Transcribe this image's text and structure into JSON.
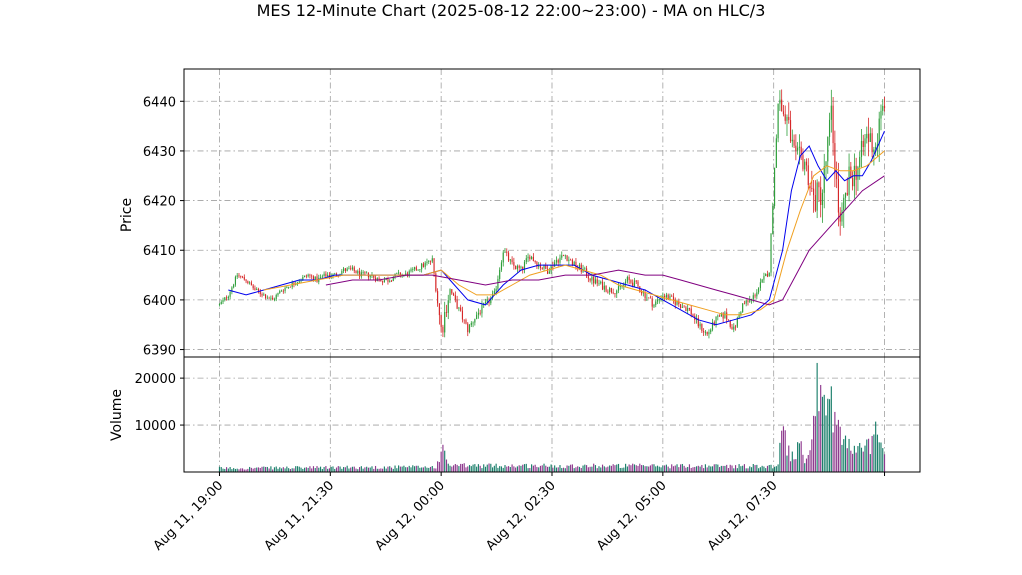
{
  "chart_data": {
    "type": "candlestick",
    "title": "MES 12-Minute Chart (2025-08-12 22:00~23:00) - MA on HLC/3",
    "price_panel": {
      "ylabel": "Price",
      "ylim": [
        6388.5,
        6446.5
      ],
      "yticks": [
        6390,
        6400,
        6410,
        6420,
        6430,
        6440
      ],
      "grid": true
    },
    "volume_panel": {
      "ylabel": "Volume",
      "ylim": [
        0,
        24500
      ],
      "yticks": [
        10000,
        20000
      ],
      "grid": true
    },
    "x_axis": {
      "tick_labels": [
        "Aug 11, 19:00",
        "Aug 11, 21:30",
        "Aug 12, 00:00",
        "Aug 12, 02:30",
        "Aug 12, 05:00",
        "Aug 12, 07:30"
      ],
      "tick_index": [
        0,
        12.5,
        25,
        37.5,
        50,
        62.5,
        75
      ],
      "range": [
        -4,
        79
      ]
    },
    "colors": {
      "up": "#2e9e3a",
      "down": "#d62728",
      "vol_up": "#1b7f6b",
      "vol_down": "#8e3a8e",
      "ma_fast": "#0000ee",
      "ma_mid": "#f0a020",
      "ma_slow": "#800080"
    },
    "close_path": [
      [
        0,
        6399
      ],
      [
        1,
        6401
      ],
      [
        2,
        6405
      ],
      [
        3,
        6404
      ],
      [
        4,
        6402
      ],
      [
        5,
        6401
      ],
      [
        6,
        6400
      ],
      [
        7,
        6402
      ],
      [
        8,
        6403
      ],
      [
        9,
        6404
      ],
      [
        10,
        6405
      ],
      [
        11,
        6404
      ],
      [
        12,
        6405
      ],
      [
        13,
        6405
      ],
      [
        14,
        6406
      ],
      [
        15,
        6406
      ],
      [
        16,
        6405
      ],
      [
        17,
        6405
      ],
      [
        18,
        6404
      ],
      [
        19,
        6404
      ],
      [
        20,
        6405
      ],
      [
        21,
        6405
      ],
      [
        22,
        6406
      ],
      [
        23,
        6407
      ],
      [
        24,
        6408
      ],
      [
        25,
        6394
      ],
      [
        26,
        6402
      ],
      [
        27,
        6398
      ],
      [
        28,
        6394
      ],
      [
        29,
        6397
      ],
      [
        30,
        6399
      ],
      [
        31,
        6401
      ],
      [
        32,
        6410
      ],
      [
        33,
        6407
      ],
      [
        34,
        6406
      ],
      [
        35,
        6409
      ],
      [
        36,
        6407
      ],
      [
        37,
        6406
      ],
      [
        38,
        6408
      ],
      [
        39,
        6409
      ],
      [
        40,
        6407
      ],
      [
        41,
        6406
      ],
      [
        42,
        6404
      ],
      [
        43,
        6403
      ],
      [
        44,
        6402
      ],
      [
        45,
        6402
      ],
      [
        46,
        6404
      ],
      [
        47,
        6403
      ],
      [
        48,
        6401
      ],
      [
        49,
        6399
      ],
      [
        50,
        6401
      ],
      [
        51,
        6400
      ],
      [
        52,
        6399
      ],
      [
        53,
        6398
      ],
      [
        54,
        6395
      ],
      [
        55,
        6393
      ],
      [
        56,
        6396
      ],
      [
        57,
        6397
      ],
      [
        58,
        6394
      ],
      [
        59,
        6399
      ],
      [
        60,
        6400
      ],
      [
        61,
        6403
      ],
      [
        62,
        6406
      ],
      [
        63,
        6440
      ],
      [
        64,
        6436
      ],
      [
        65,
        6428
      ],
      [
        66,
        6428
      ],
      [
        67,
        6420
      ],
      [
        68,
        6422
      ],
      [
        69,
        6437
      ],
      [
        70,
        6414
      ],
      [
        71,
        6424
      ],
      [
        72,
        6427
      ],
      [
        73,
        6433
      ],
      [
        74,
        6431
      ],
      [
        75,
        6440
      ]
    ],
    "moving_averages": [
      {
        "key": "fast",
        "values": [
          [
            1,
            6402
          ],
          [
            3,
            6401
          ],
          [
            5,
            6402
          ],
          [
            7,
            6403
          ],
          [
            9,
            6404
          ],
          [
            11,
            6404
          ],
          [
            13,
            6405
          ],
          [
            15,
            6405
          ],
          [
            17,
            6405
          ],
          [
            19,
            6405
          ],
          [
            21,
            6405
          ],
          [
            23,
            6405
          ],
          [
            25,
            6406
          ],
          [
            26,
            6404
          ],
          [
            28,
            6400
          ],
          [
            30,
            6399
          ],
          [
            32,
            6403
          ],
          [
            34,
            6406
          ],
          [
            36,
            6407
          ],
          [
            38,
            6407
          ],
          [
            40,
            6407
          ],
          [
            42,
            6405
          ],
          [
            44,
            6404
          ],
          [
            46,
            6403
          ],
          [
            48,
            6402
          ],
          [
            50,
            6400
          ],
          [
            52,
            6398
          ],
          [
            54,
            6396
          ],
          [
            56,
            6395
          ],
          [
            58,
            6396
          ],
          [
            60,
            6397
          ],
          [
            62,
            6400
          ],
          [
            63.5,
            6410
          ],
          [
            64.5,
            6422
          ],
          [
            65.5,
            6429
          ],
          [
            66.5,
            6431
          ],
          [
            67.5,
            6427
          ],
          [
            68.5,
            6424
          ],
          [
            69.5,
            6426
          ],
          [
            70.5,
            6424
          ],
          [
            71.5,
            6425
          ],
          [
            72.5,
            6425
          ],
          [
            73.5,
            6428
          ],
          [
            75,
            6434
          ]
        ]
      },
      {
        "key": "mid",
        "values": [
          [
            5,
            6402
          ],
          [
            8,
            6403
          ],
          [
            11,
            6404
          ],
          [
            14,
            6405
          ],
          [
            17,
            6405
          ],
          [
            20,
            6405
          ],
          [
            23,
            6405
          ],
          [
            25,
            6406
          ],
          [
            27,
            6403
          ],
          [
            29,
            6401
          ],
          [
            31,
            6401
          ],
          [
            33,
            6403
          ],
          [
            35,
            6405
          ],
          [
            37,
            6406
          ],
          [
            39,
            6407
          ],
          [
            41,
            6406
          ],
          [
            43,
            6405
          ],
          [
            45,
            6403
          ],
          [
            47,
            6402
          ],
          [
            49,
            6401
          ],
          [
            51,
            6400
          ],
          [
            53,
            6399
          ],
          [
            55,
            6398
          ],
          [
            57,
            6397
          ],
          [
            59,
            6397
          ],
          [
            61,
            6398
          ],
          [
            62.5,
            6400
          ],
          [
            64,
            6410
          ],
          [
            65.5,
            6418
          ],
          [
            67,
            6425
          ],
          [
            68.5,
            6427
          ],
          [
            70,
            6426
          ],
          [
            71.5,
            6426
          ],
          [
            73,
            6427
          ],
          [
            75,
            6430
          ]
        ]
      },
      {
        "key": "slow",
        "values": [
          [
            12,
            6403
          ],
          [
            15,
            6404
          ],
          [
            18,
            6404
          ],
          [
            21,
            6405
          ],
          [
            24,
            6405
          ],
          [
            27,
            6404
          ],
          [
            30,
            6403
          ],
          [
            33,
            6404
          ],
          [
            36,
            6404
          ],
          [
            39,
            6405
          ],
          [
            42,
            6405
          ],
          [
            45,
            6406
          ],
          [
            48,
            6405
          ],
          [
            50,
            6405
          ],
          [
            52,
            6404
          ],
          [
            54,
            6403
          ],
          [
            56,
            6402
          ],
          [
            58,
            6401
          ],
          [
            60,
            6400
          ],
          [
            62,
            6399
          ],
          [
            63.5,
            6400
          ],
          [
            65,
            6405
          ],
          [
            66.5,
            6410
          ],
          [
            68,
            6413
          ],
          [
            69.5,
            6416
          ],
          [
            71,
            6419
          ],
          [
            72.5,
            6422
          ],
          [
            75,
            6425
          ]
        ]
      }
    ],
    "volume_regime": [
      [
        0,
        900
      ],
      [
        24.5,
        1200
      ],
      [
        25,
        5500
      ],
      [
        26,
        1500
      ],
      [
        63,
        1400
      ],
      [
        63.5,
        16000
      ],
      [
        64,
        6000
      ],
      [
        64.5,
        3500
      ],
      [
        65,
        4500
      ],
      [
        65.5,
        6000
      ],
      [
        66,
        3000
      ],
      [
        66.5,
        4000
      ],
      [
        67,
        15000
      ],
      [
        67.5,
        21000
      ],
      [
        68,
        24000
      ],
      [
        68.5,
        15000
      ],
      [
        69,
        17000
      ],
      [
        69.5,
        12000
      ],
      [
        70,
        9000
      ],
      [
        70.5,
        7000
      ],
      [
        71,
        6500
      ],
      [
        71.5,
        5000
      ],
      [
        72,
        5500
      ],
      [
        72.5,
        4800
      ],
      [
        73,
        6000
      ],
      [
        73.5,
        7000
      ],
      [
        74,
        9000
      ],
      [
        74.5,
        12000
      ],
      [
        75,
        4000
      ]
    ]
  }
}
